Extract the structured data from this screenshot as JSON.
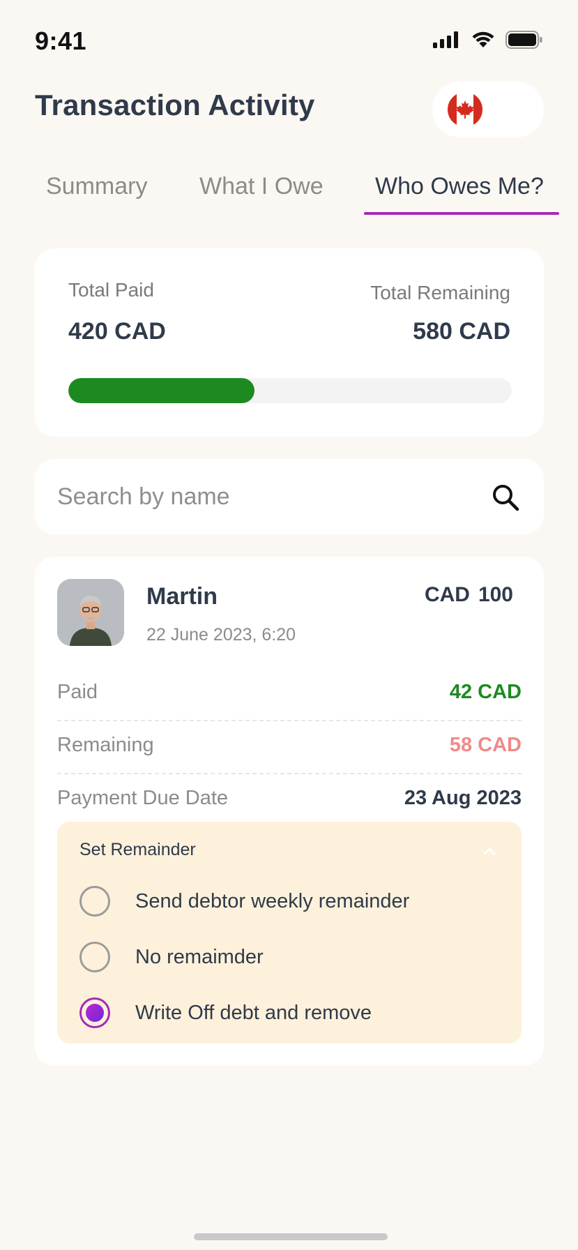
{
  "status_bar": {
    "time": "9:41"
  },
  "header": {
    "title": "Transaction Activity",
    "country_icon": "canada-flag-icon"
  },
  "tabs": [
    {
      "label": "Summary",
      "active": false
    },
    {
      "label": "What I Owe",
      "active": false
    },
    {
      "label": "Who Owes Me?",
      "active": true
    }
  ],
  "summary": {
    "total_paid_label": "Total Paid",
    "total_paid_value": "420 CAD",
    "total_remaining_label": "Total Remaining",
    "total_remaining_value": "580 CAD",
    "progress_fraction": 0.42,
    "progress_color": "#1d8a21"
  },
  "search": {
    "placeholder": "Search by name",
    "value": ""
  },
  "debtor": {
    "name": "Martin",
    "date": "22 June 2023, 6:20",
    "currency": "CAD",
    "amount": "100",
    "paid_label": "Paid",
    "paid_value": "42 CAD",
    "paid_color": "#1d8a21",
    "remaining_label": "Remaining",
    "remaining_value": "58 CAD",
    "remaining_color": "#f08a8a",
    "due_label": "Payment Due Date",
    "due_value": "23 Aug 2023"
  },
  "reminder": {
    "title": "Set Remainder",
    "options": [
      {
        "label": "Send debtor weekly remainder",
        "selected": false
      },
      {
        "label": "No remaimder",
        "selected": false
      },
      {
        "label": "Write Off debt and remove",
        "selected": true
      }
    ]
  },
  "colors": {
    "accent": "#a42bb5",
    "background": "#fbf8f3",
    "reminder_bg": "#fdf1dc"
  }
}
